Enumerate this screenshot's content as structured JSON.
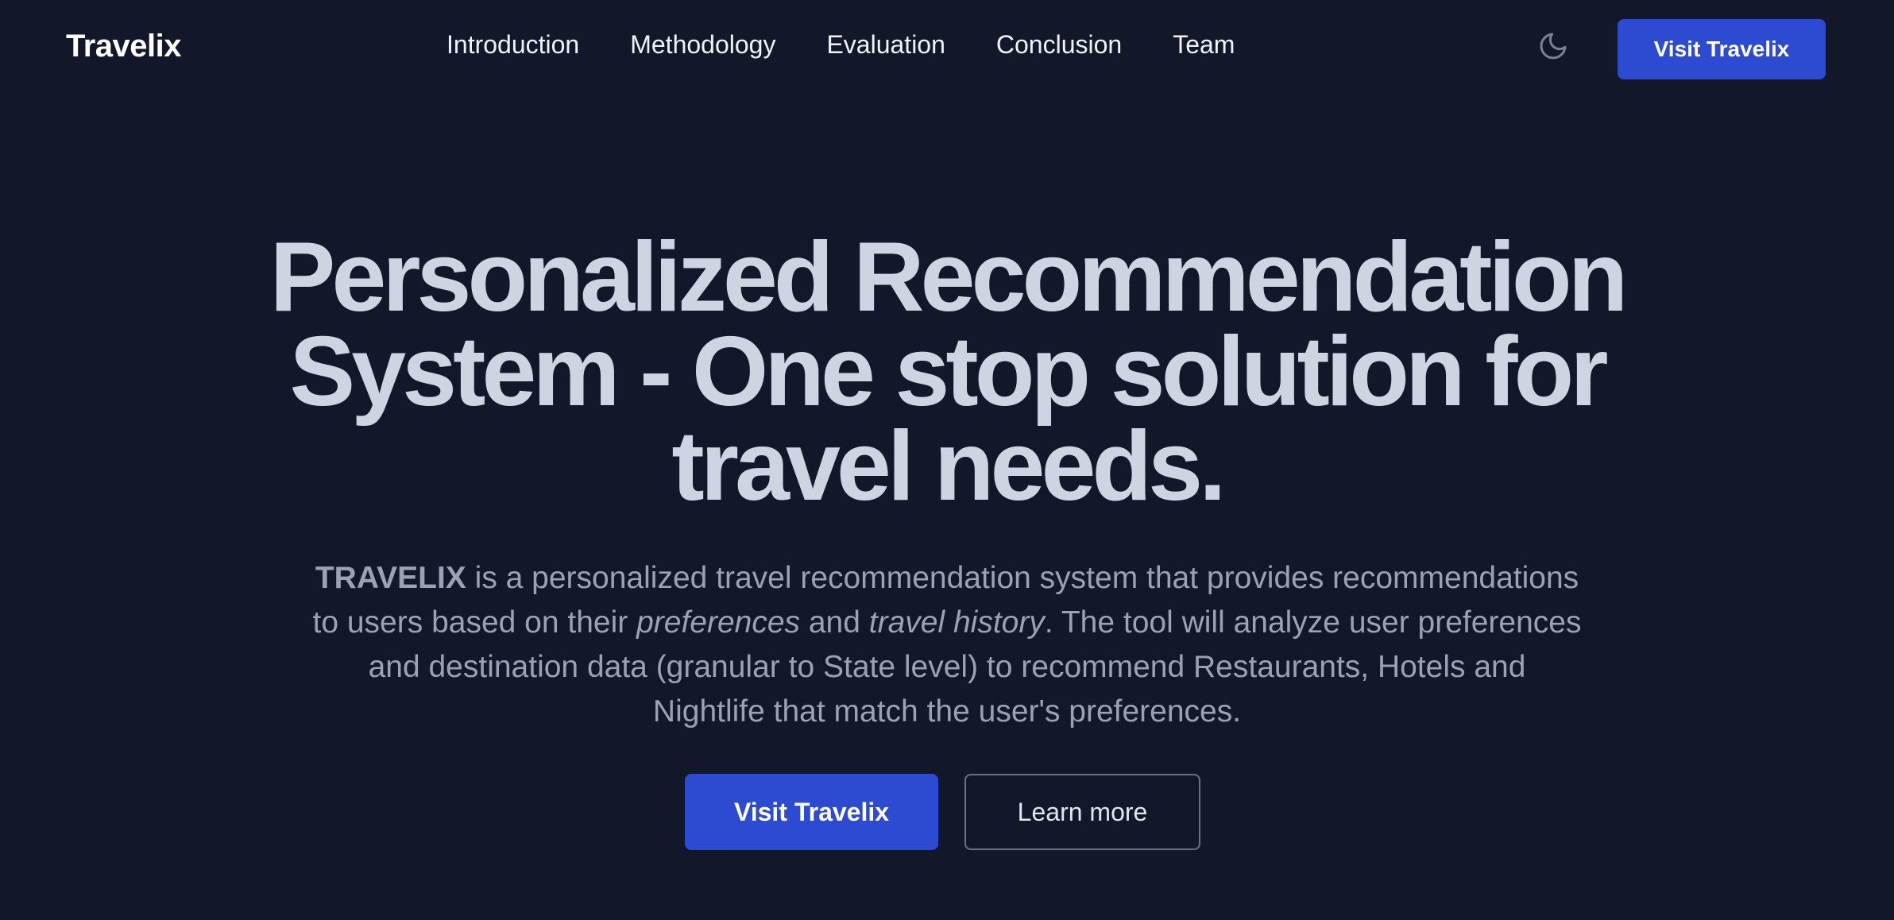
{
  "nav": {
    "brand": "Travelix",
    "links": [
      "Introduction",
      "Methodology",
      "Evaluation",
      "Conclusion",
      "Team"
    ],
    "theme_toggle_icon": "moon-icon",
    "cta_label": "Visit Travelix"
  },
  "hero": {
    "title": "Personalized Recommendation System - One stop solution for travel needs.",
    "description": {
      "brand_strong": "TRAVELIX",
      "part1": " is a personalized travel recommendation system that provides recommendations to users based on their ",
      "em1": "preferences",
      "part2": " and ",
      "em2": "travel history",
      "part3": ". The tool will analyze user preferences and destination data (granular to State level) to recommend Restaurants, Hotels and Nightlife that match the user's preferences."
    },
    "primary_button": "Visit Travelix",
    "secondary_button": "Learn more"
  },
  "colors": {
    "background": "#12172a",
    "accent": "#2d4bd1",
    "title_text": "#cfd4e2",
    "body_text": "#9aa2b4"
  }
}
